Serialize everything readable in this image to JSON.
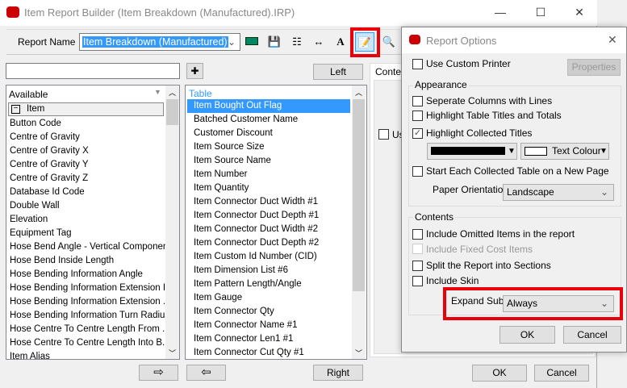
{
  "window": {
    "title": "Item Report Builder (Item Breakdown (Manufactured).IRP)",
    "minimize": "—",
    "maximize": "☐",
    "close": "✕"
  },
  "toolbar": {
    "report_name_label": "Report Name",
    "report_name_value": "Item Breakdown (Manufactured)"
  },
  "left_panel": {
    "search_value": "",
    "add_label": "✚",
    "left_button": "Left",
    "header": "Available",
    "tree_root": "Item",
    "items": [
      "Button Code",
      "Centre of Gravity",
      "Centre of Gravity X",
      "Centre of Gravity Y",
      "Centre of Gravity Z",
      "Database Id Code",
      "Double Wall",
      "Elevation",
      "Equipment Tag",
      "Hose Bend Angle - Vertical Component",
      "Hose Bend Inside Length",
      "Hose Bending Information Angle",
      "Hose Bending Information Extension In",
      "Hose Bending Information Extension ...",
      "Hose Bending Information Turn Radius",
      "Hose Centre To Centre Length From ...",
      "Hose Centre To Centre Length Into B...",
      "Item Alias"
    ]
  },
  "table_panel": {
    "header": "Table",
    "selected": "Item Bought Out Flag",
    "items": [
      "Item Bought Out Flag",
      "Batched Customer Name",
      "Customer Discount",
      "Item Source Size",
      "Item Source Name",
      "Item Number",
      "Item Quantity",
      "Item Connector Duct Width #1",
      "Item Connector Duct Depth #1",
      "Item Connector Duct Width #2",
      "Item Connector Duct Depth #2",
      "Item Custom Id Number (CID)",
      "Item Dimension List #6",
      "Item Pattern Length/Angle",
      "Item Gauge",
      "Item Connector Qty",
      "Item Connector Name #1",
      "Item Connector Len1 #1",
      "Item Connector Cut Qty #1"
    ],
    "right_button": "Right"
  },
  "content_panel": {
    "tab_label": "Conten",
    "checkbox_label": "Us"
  },
  "bottom": {
    "move_right": "⇨",
    "move_left": "⇦",
    "ok": "OK",
    "cancel": "Cancel"
  },
  "dialog": {
    "title": "Report Options",
    "close": "✕",
    "use_custom_printer": "Use Custom Printer",
    "properties": "Properties",
    "appearance": {
      "title": "Appearance",
      "separate_columns": "Seperate Columns with Lines",
      "highlight_titles": "Highlight Table Titles and Totals",
      "highlight_collected": "Highlight Collected Titles",
      "text_colour": "Text Colour",
      "new_page": "Start Each Collected Table on a New Page",
      "paper_orientation_label": "Paper Orientation",
      "paper_orientation": "Landscape"
    },
    "contents": {
      "title": "Contents",
      "include_omitted": "Include Omitted Items in the report",
      "include_fixed": "Include Fixed Cost Items",
      "split_sections": "Split the Report into Sections",
      "include_skin": "Include Skin",
      "expand_sub_label": "Expand Sub",
      "expand_sub": "Always"
    },
    "ok": "OK",
    "cancel": "Cancel"
  },
  "colors": {
    "highlight": "#3399ff",
    "annotation": "#e8000b",
    "swatch_fill": "#000000",
    "swatch_text": "#ffffff"
  }
}
